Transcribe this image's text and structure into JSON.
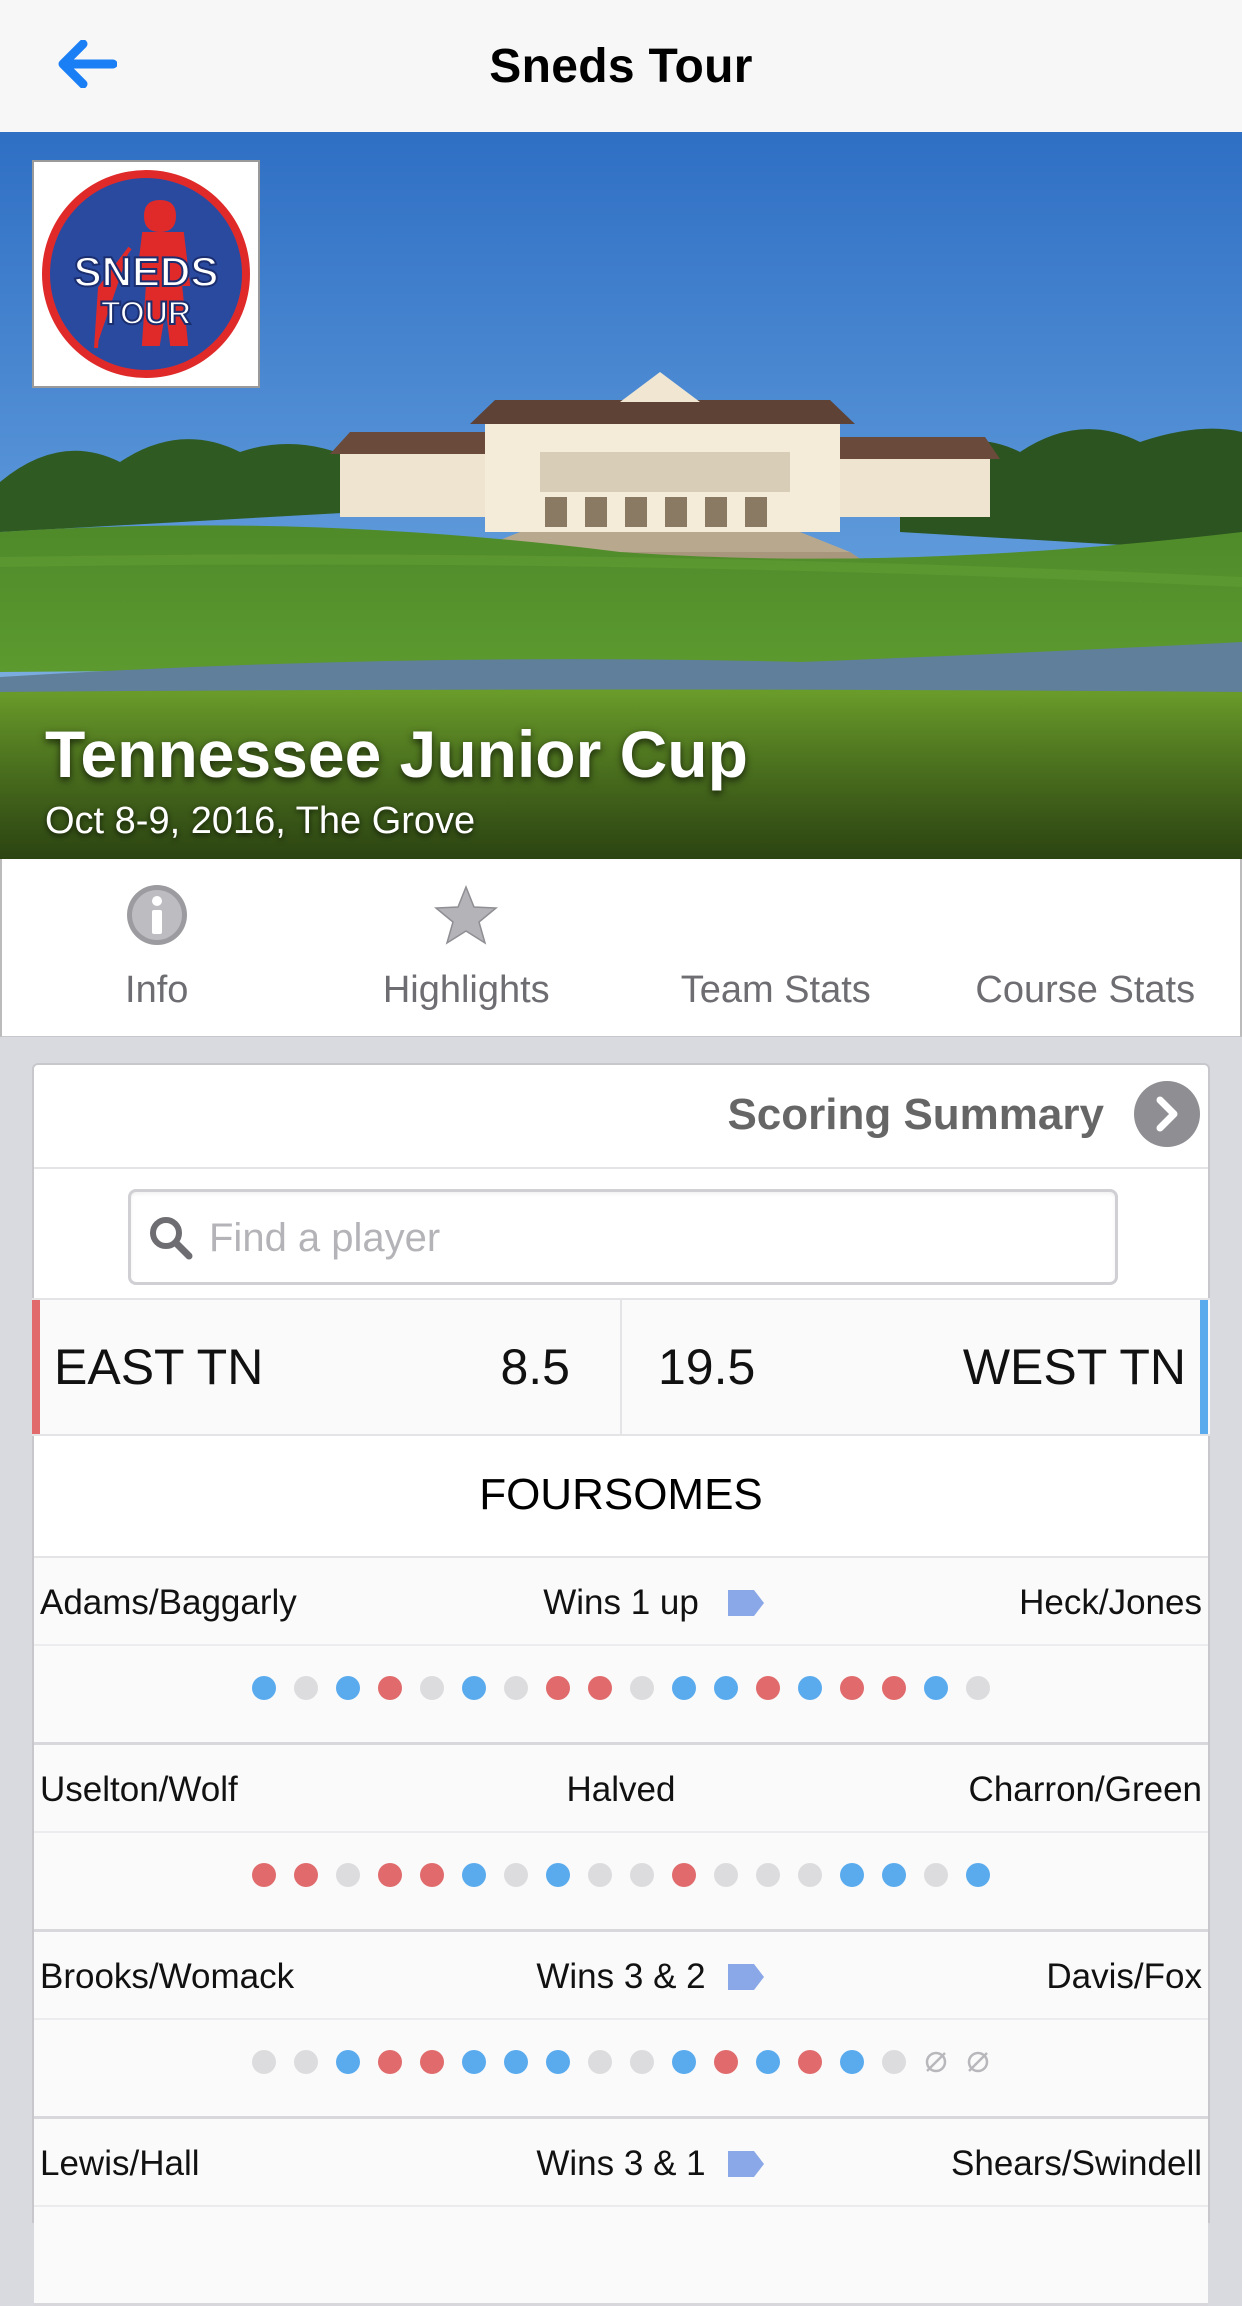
{
  "nav": {
    "title": "Sneds Tour",
    "back_icon": "back-arrow-icon",
    "accent": "#1a7ef5"
  },
  "hero": {
    "logo_line1": "SNEDS",
    "logo_line2": "TOUR",
    "title": "Tennessee Junior Cup",
    "subtitle": "Oct 8-9, 2016, The Grove"
  },
  "tabs": [
    {
      "label": "Info",
      "icon": "info-icon"
    },
    {
      "label": "Highlights",
      "icon": "star-icon"
    },
    {
      "label": "Team Stats",
      "icon": ""
    },
    {
      "label": "Course Stats",
      "icon": ""
    }
  ],
  "summary": {
    "label": "Scoring Summary"
  },
  "search": {
    "placeholder": "Find a player",
    "value": ""
  },
  "score": {
    "left_team": "EAST TN",
    "left_points": "8.5",
    "left_color": "#e06a6c",
    "right_points": "19.5",
    "right_team": "WEST TN",
    "right_color": "#5aabee"
  },
  "section": {
    "title": "FOURSOMES"
  },
  "matches": [
    {
      "left": "Adams/Baggarly",
      "result": "Wins 1 up",
      "flag": true,
      "right": "Heck/Jones",
      "holes": [
        "b",
        "g",
        "b",
        "r",
        "g",
        "b",
        "g",
        "r",
        "r",
        "g",
        "b",
        "b",
        "r",
        "b",
        "r",
        "r",
        "b",
        "g"
      ]
    },
    {
      "left": "Uselton/Wolf",
      "result": "Halved",
      "flag": false,
      "right": "Charron/Green",
      "holes": [
        "r",
        "r",
        "g",
        "r",
        "r",
        "b",
        "g",
        "b",
        "g",
        "g",
        "r",
        "g",
        "g",
        "g",
        "b",
        "b",
        "g",
        "b"
      ]
    },
    {
      "left": "Brooks/Womack",
      "result": "Wins 3 & 2",
      "flag": true,
      "right": "Davis/Fox",
      "holes": [
        "g",
        "g",
        "b",
        "r",
        "r",
        "b",
        "b",
        "b",
        "g",
        "g",
        "b",
        "r",
        "b",
        "r",
        "b",
        "g",
        "x",
        "x"
      ]
    },
    {
      "left": "Lewis/Hall",
      "result": "Wins 3 & 1",
      "flag": true,
      "right": "Shears/Swindell",
      "holes": []
    }
  ]
}
